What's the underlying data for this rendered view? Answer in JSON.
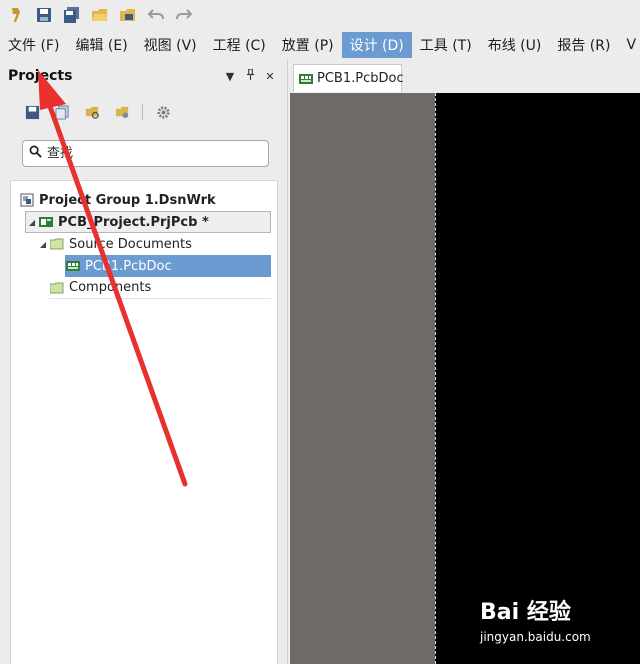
{
  "quick_access": {
    "icons": [
      "app-logo-icon",
      "save-icon",
      "save-all-icon",
      "open-folder-icon",
      "open-project-icon",
      "undo-icon",
      "redo-icon"
    ]
  },
  "menu": {
    "items": [
      "文件 (F)",
      "编辑 (E)",
      "视图 (V)",
      "工程 (C)",
      "放置 (P)",
      "设计 (D)",
      "工具 (T)",
      "布线 (U)",
      "报告 (R)",
      "V"
    ],
    "active_index": 5
  },
  "projects_panel": {
    "title": "Projects",
    "dropdown_glyph": "▼",
    "pin_glyph": "📌",
    "close_glyph": "✕",
    "search": {
      "placeholder": "查找",
      "value": ""
    },
    "tree": {
      "group": "Project Group 1.DsnWrk",
      "project": "PCB_Project.PrjPcb *",
      "source_folder": "Source Documents",
      "pcb_doc": "PCB1.PcbDoc",
      "components_folder": "Components"
    }
  },
  "document": {
    "tab_label": "PCB1.PcbDoc"
  },
  "watermark": {
    "logo": "Bai 经验",
    "url": "jingyan.baidu.com"
  },
  "colors": {
    "active_menu": "#6b9bd1",
    "selection": "#6b9bd1",
    "annotation_arrow": "#e8312f",
    "canvas_gray": "#6e6a68",
    "canvas_black": "#000000"
  }
}
